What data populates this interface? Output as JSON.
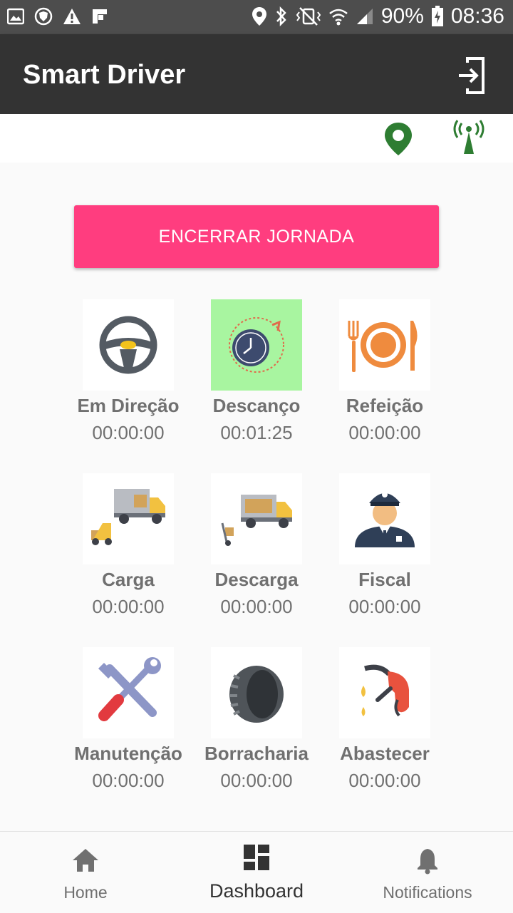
{
  "status_bar": {
    "battery": "90%",
    "time": "08:36"
  },
  "app": {
    "title": "Smart Driver"
  },
  "actions": {
    "end_shift_label": "ENCERRAR JORNADA"
  },
  "activities": [
    {
      "label": "Em Direção",
      "time": "00:00:00",
      "icon": "steering-wheel-icon",
      "active": false
    },
    {
      "label": "Descanço",
      "time": "00:01:25",
      "icon": "clock-icon",
      "active": true
    },
    {
      "label": "Refeição",
      "time": "00:00:00",
      "icon": "plate-cutlery-icon",
      "active": false
    },
    {
      "label": "Carga",
      "time": "00:00:00",
      "icon": "loading-truck-icon",
      "active": false
    },
    {
      "label": "Descarga",
      "time": "00:00:00",
      "icon": "unloading-truck-icon",
      "active": false
    },
    {
      "label": "Fiscal",
      "time": "00:00:00",
      "icon": "officer-icon",
      "active": false
    },
    {
      "label": "Manutenção",
      "time": "00:00:00",
      "icon": "tools-icon",
      "active": false
    },
    {
      "label": "Borracharia",
      "time": "00:00:00",
      "icon": "tire-icon",
      "active": false
    },
    {
      "label": "Abastecer",
      "time": "00:00:00",
      "icon": "fuel-nozzle-icon",
      "active": false
    }
  ],
  "bottom_nav": [
    {
      "label": "Home",
      "icon": "home-icon",
      "active": false
    },
    {
      "label": "Dashboard",
      "icon": "dashboard-icon",
      "active": true
    },
    {
      "label": "Notifications",
      "icon": "bell-icon",
      "active": false
    }
  ],
  "colors": {
    "accent": "#ff3d7f",
    "appbar": "#333333",
    "active_tile": "#a8f5a0",
    "location_green": "#2e7d32"
  }
}
